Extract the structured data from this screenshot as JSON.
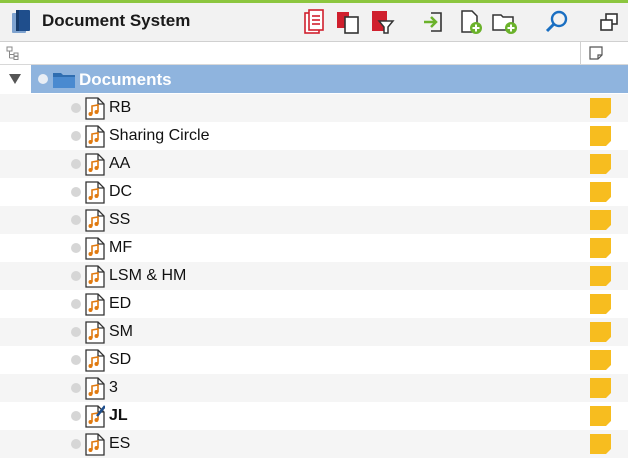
{
  "window": {
    "title": "Document System"
  },
  "toolbar": {
    "buttons": [
      {
        "name": "doc-browser-button",
        "icon": "document-list-icon",
        "color": "#d0202e"
      },
      {
        "name": "doc-copy-button",
        "icon": "documents-copy-icon",
        "color": "#d0202e"
      },
      {
        "name": "doc-filter-button",
        "icon": "document-filter-icon",
        "color": "#d0202e"
      },
      {
        "name": "import-button",
        "icon": "import-arrow-icon",
        "color": "#6bb22b"
      },
      {
        "name": "new-document-button",
        "icon": "new-document-icon",
        "color": "#6bb22b"
      },
      {
        "name": "new-folder-button",
        "icon": "new-folder-icon",
        "color": "#6bb22b"
      },
      {
        "name": "search-button",
        "icon": "search-icon",
        "color": "#1a6fc2"
      },
      {
        "name": "undock-button",
        "icon": "undock-window-icon",
        "color": "#333333"
      }
    ]
  },
  "tree": {
    "root": {
      "label": "Documents",
      "expanded": true,
      "selected": true,
      "selection_color": "#8fb4de"
    },
    "documents": [
      {
        "label": "RB",
        "type": "audio"
      },
      {
        "label": "Sharing Circle",
        "type": "audio"
      },
      {
        "label": "AA",
        "type": "audio"
      },
      {
        "label": "DC",
        "type": "audio"
      },
      {
        "label": "SS",
        "type": "audio"
      },
      {
        "label": "MF",
        "type": "audio"
      },
      {
        "label": "LSM & HM",
        "type": "audio"
      },
      {
        "label": "ED",
        "type": "audio"
      },
      {
        "label": "SM",
        "type": "audio"
      },
      {
        "label": "SD",
        "type": "audio"
      },
      {
        "label": "3",
        "type": "audio"
      },
      {
        "label": "JL",
        "type": "audio-edit",
        "bold": true
      },
      {
        "label": "ES",
        "type": "audio"
      }
    ],
    "memo_color": "#f7bd1f"
  }
}
